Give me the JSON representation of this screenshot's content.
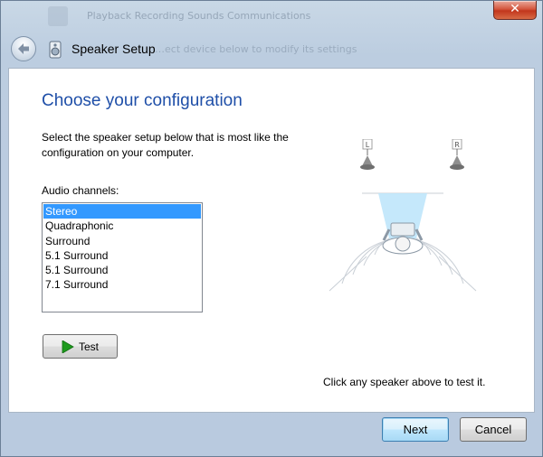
{
  "window": {
    "title": "Speaker Setup",
    "close_label": "✕",
    "background_ghost_text": "Playback  Recording  Sounds  Communications",
    "background_ghost_text2": "…ect device below to modify its settings"
  },
  "page": {
    "heading": "Choose your configuration",
    "description": "Select the speaker setup below that is most like the configuration on your computer.",
    "channels_label": "Audio channels:",
    "channels": [
      {
        "label": "Stereo",
        "selected": true
      },
      {
        "label": "Quadraphonic",
        "selected": false
      },
      {
        "label": "Surround",
        "selected": false
      },
      {
        "label": "5.1 Surround",
        "selected": false
      },
      {
        "label": "5.1 Surround",
        "selected": false
      },
      {
        "label": "7.1 Surround",
        "selected": false
      }
    ],
    "test_label": "Test",
    "speaker_left_label": "L",
    "speaker_right_label": "R",
    "hint": "Click any speaker above to test it."
  },
  "footer": {
    "next_label": "Next",
    "cancel_label": "Cancel"
  },
  "colors": {
    "heading": "#1f4fa8",
    "selection": "#3399ff",
    "play_icon": "#1e9a1e",
    "close_button": "#c2361c"
  }
}
